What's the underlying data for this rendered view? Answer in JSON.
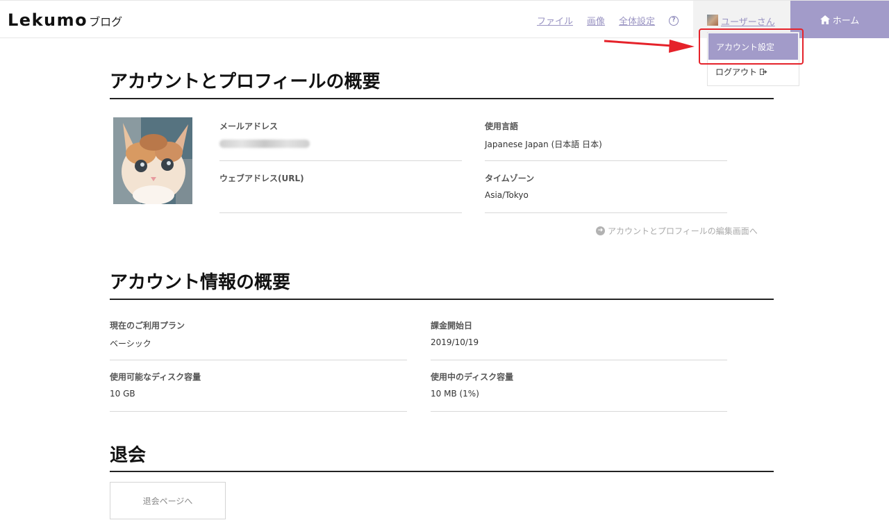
{
  "header": {
    "logo_main": "Lekumo",
    "logo_sub": "ブログ",
    "nav": [
      "ファイル",
      "画像",
      "全体設定"
    ],
    "help_symbol": "?",
    "user_name": "ユーザーさん",
    "home_label": "ホーム"
  },
  "dropdown": {
    "account_settings": "アカウント設定",
    "logout": "ログアウト"
  },
  "profile": {
    "title": "アカウントとプロフィールの概要",
    "email_label": "メールアドレス",
    "url_label": "ウェブアドレス(URL)",
    "url_value": "",
    "language_label": "使用言語",
    "language_value": "Japanese Japan (日本語 日本)",
    "timezone_label": "タイムゾーン",
    "timezone_value": "Asia/Tokyo",
    "edit_link": "アカウントとプロフィールの編集画面へ"
  },
  "account": {
    "title": "アカウント情報の概要",
    "plan_label": "現在のご利用プラン",
    "plan_value": "ベーシック",
    "billing_label": "課金開始日",
    "billing_value": "2019/10/19",
    "disk_avail_label": "使用可能なディスク容量",
    "disk_avail_value": "10 GB",
    "disk_used_label": "使用中のディスク容量",
    "disk_used_value": "10 MB (1%)"
  },
  "withdraw": {
    "title": "退会",
    "button": "退会ページへ"
  },
  "colors": {
    "accent": "#a29bc9",
    "link": "#9993c2",
    "highlight": "#e5222a"
  }
}
